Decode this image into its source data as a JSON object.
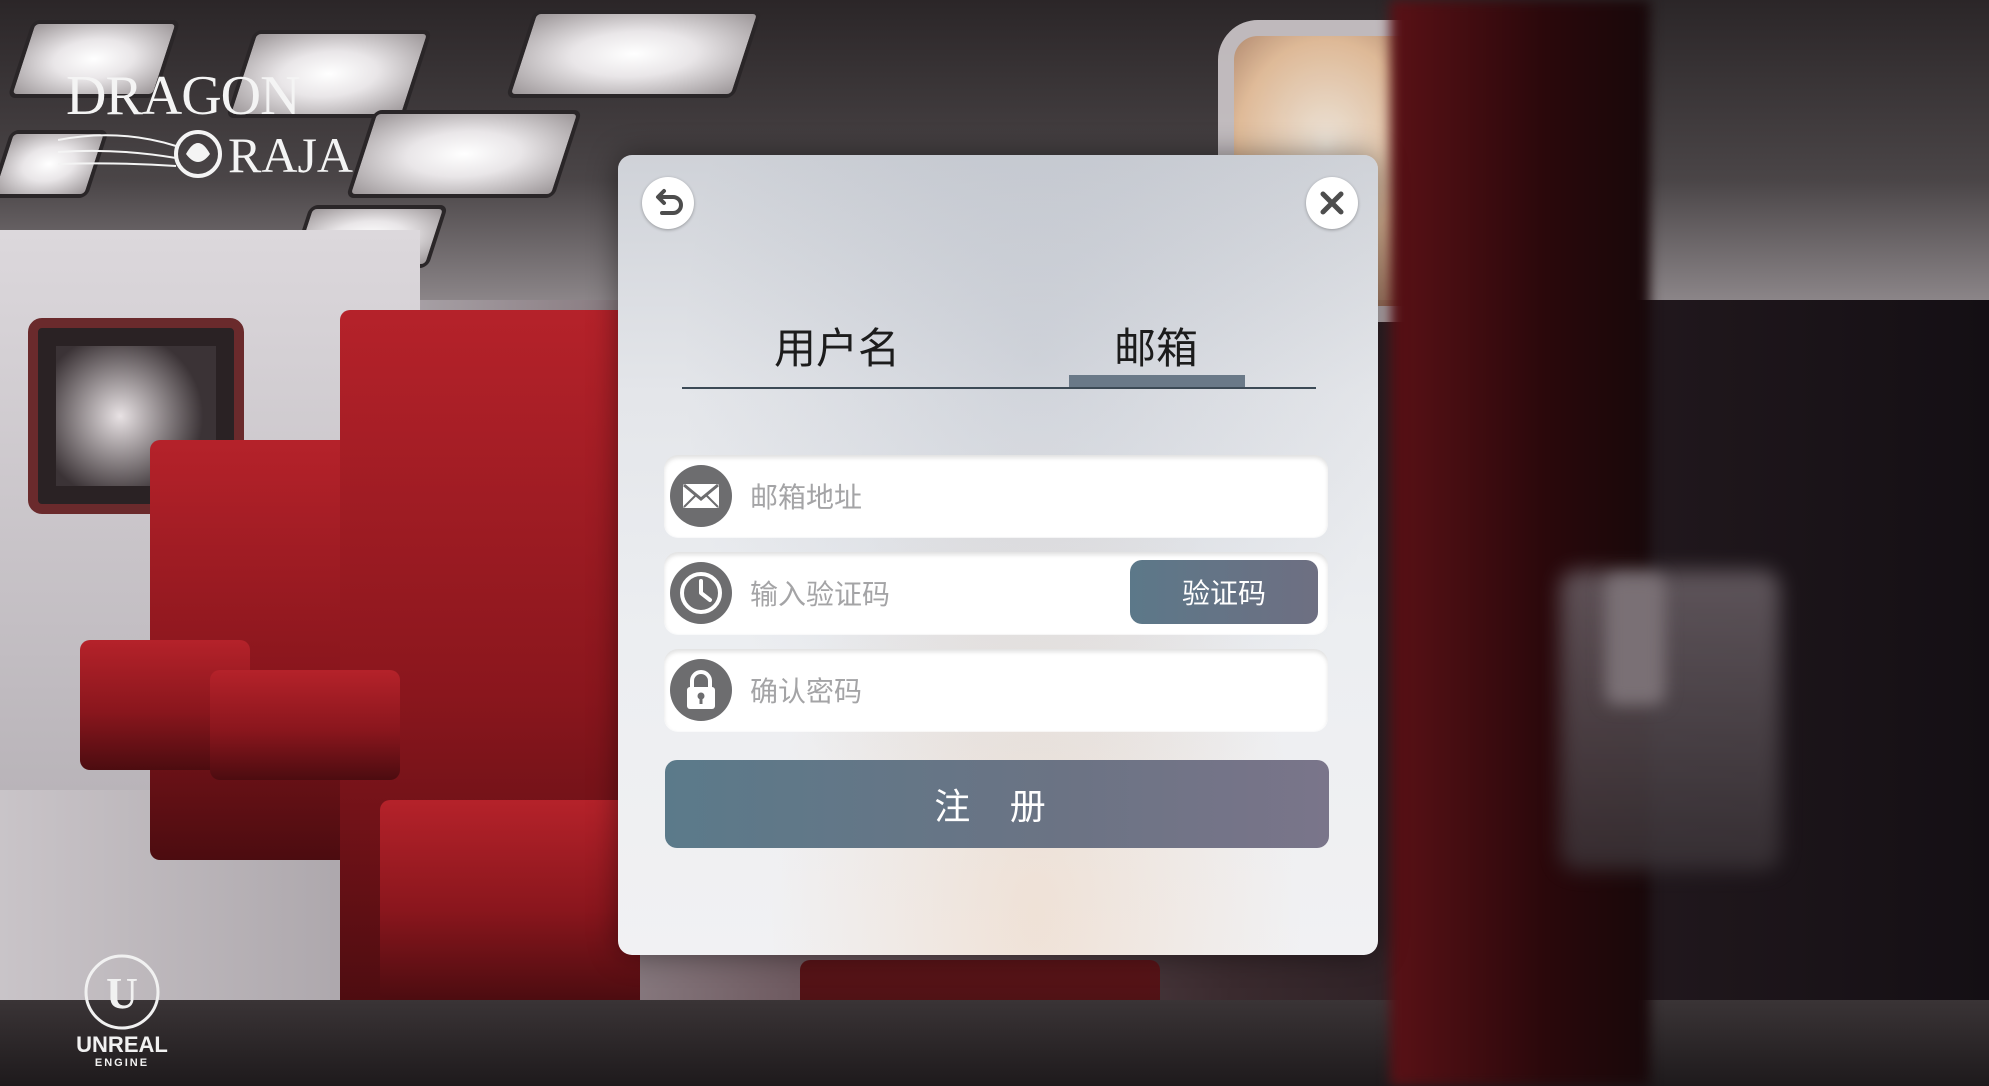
{
  "brand": {
    "game_logo_line1": "DRAGON",
    "game_logo_line2": "RAJA",
    "engine_logo_name": "UNREAL",
    "engine_logo_sub": "ENGINE",
    "engine_logo_glyph": "U"
  },
  "dialog": {
    "back_icon": "back-arrow-icon",
    "close_icon": "close-icon",
    "tabs": [
      {
        "label": "用户名",
        "active": false
      },
      {
        "label": "邮箱",
        "active": true
      }
    ],
    "fields": {
      "email": {
        "icon": "envelope-icon",
        "placeholder": "邮箱地址",
        "value": ""
      },
      "code": {
        "icon": "clock-icon",
        "placeholder": "输入验证码",
        "value": "",
        "button_label": "验证码"
      },
      "password": {
        "icon": "lock-icon",
        "placeholder": "确认密码",
        "value": ""
      }
    },
    "register_label": "注 册"
  },
  "colors": {
    "accent": "#5b7a8a",
    "tab_indicator": "#6a7988",
    "icon_bg": "#6d6d6f"
  }
}
